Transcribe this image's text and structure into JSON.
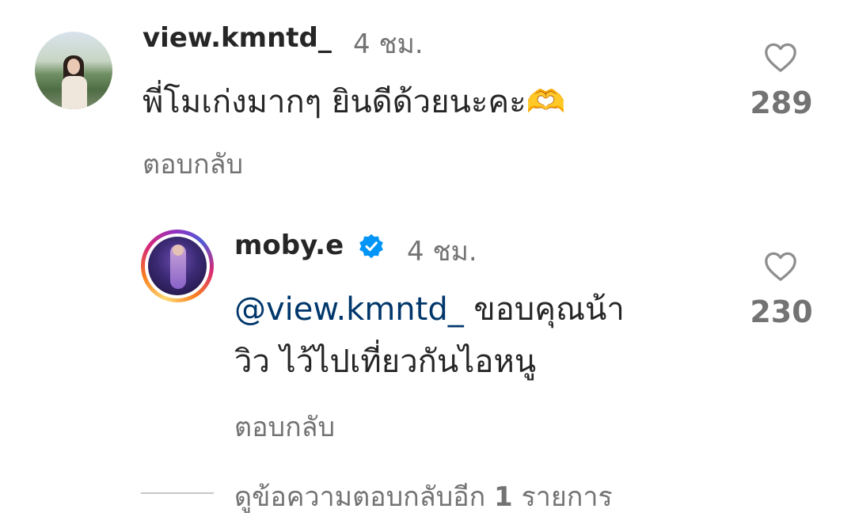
{
  "comment": {
    "username": "view.kmntd_",
    "time": "4 ชม.",
    "text": "พี่โมเก่งมากๆ ยินดีด้วยนะคะ🫶",
    "likes": "289",
    "reply_label": "ตอบกลับ"
  },
  "reply": {
    "username": "moby.e",
    "time": "4 ชม.",
    "mention": "@view.kmntd_",
    "text_line1": " ขอบคุณน้า",
    "text_line2": "วิว ไว้ไปเที่ยวกันไอหนู",
    "likes": "230",
    "reply_label": "ตอบกลับ"
  },
  "view_more": {
    "prefix": "ดูข้อความตอบกลับอีก ",
    "count": "1",
    "suffix": " รายการ"
  },
  "colors": {
    "text_primary": "#262626",
    "text_secondary": "#737373",
    "mention": "#00376b",
    "verified_badge": "#0095f6"
  },
  "icons": {
    "like": "heart-outline-icon",
    "verified": "verified-badge-icon"
  }
}
